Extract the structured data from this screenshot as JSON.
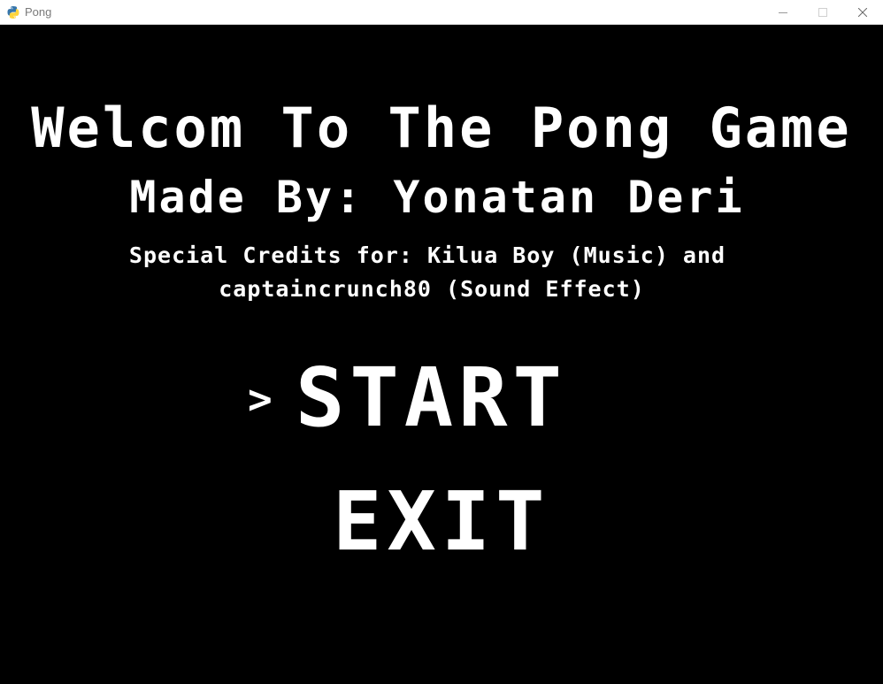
{
  "window": {
    "title": "Pong",
    "icon": "python-icon",
    "controls": {
      "minimize": "minimize-icon",
      "maximize": "maximize-icon",
      "close": "close-icon"
    }
  },
  "game": {
    "welcome_text": "Welcom To The Pong Game",
    "made_by_text": "Made By: Yonatan Deri",
    "credits_line1": "Special Credits for: Kilua Boy (Music) and",
    "credits_line2": "captaincrunch80 (Sound Effect)",
    "menu": {
      "selector": ">",
      "selected_index": 0,
      "items": [
        {
          "label": "START"
        },
        {
          "label": "EXIT"
        }
      ]
    },
    "colors": {
      "background": "#000000",
      "text": "#ffffff"
    }
  }
}
